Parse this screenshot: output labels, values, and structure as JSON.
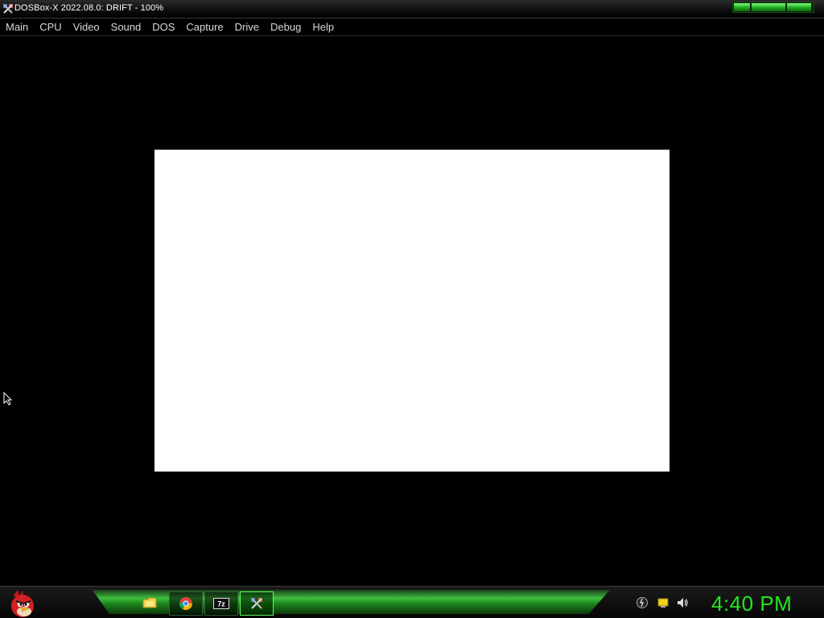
{
  "window": {
    "title": "DOSBox-X 2022.08.0: DRIFT - 100%"
  },
  "menu": {
    "items": [
      {
        "label": "Main"
      },
      {
        "label": "CPU"
      },
      {
        "label": "Video"
      },
      {
        "label": "Sound"
      },
      {
        "label": "DOS"
      },
      {
        "label": "Capture"
      },
      {
        "label": "Drive"
      },
      {
        "label": "Debug"
      },
      {
        "label": "Help"
      }
    ]
  },
  "display": {
    "content": "blank white emulated screen"
  },
  "taskbar": {
    "start_icon": "angry-bird-start-orb",
    "pinned": [
      {
        "icon": "file-explorer-icon"
      },
      {
        "icon": "chrome-icon"
      },
      {
        "icon": "7zip-icon",
        "label": "7z"
      },
      {
        "icon": "dosbox-x-icon",
        "active": true
      }
    ],
    "tray": [
      {
        "icon": "network-icon"
      },
      {
        "icon": "action-center-icon"
      },
      {
        "icon": "volume-icon"
      }
    ],
    "clock": "4:40 PM"
  },
  "colors": {
    "accent": "#22e622",
    "taskbar_green": "#3fbf3f",
    "menu_text": "#d8d8d8"
  }
}
